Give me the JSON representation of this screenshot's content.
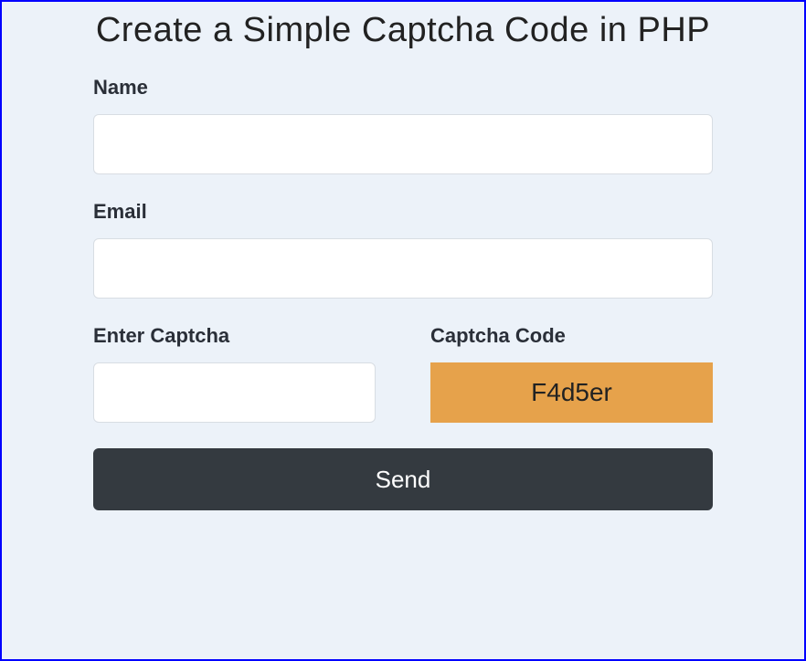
{
  "title": "Create a Simple Captcha Code in PHP",
  "form": {
    "name": {
      "label": "Name",
      "value": ""
    },
    "email": {
      "label": "Email",
      "value": ""
    },
    "captcha_input": {
      "label": "Enter Captcha",
      "value": ""
    },
    "captcha_code": {
      "label": "Captcha Code",
      "value": "F4d5er"
    },
    "submit_label": "Send"
  },
  "colors": {
    "border": "#0000ff",
    "panel_bg": "#ecf2f9",
    "captcha_bg": "#e6a24b",
    "button_bg": "#343a40"
  }
}
